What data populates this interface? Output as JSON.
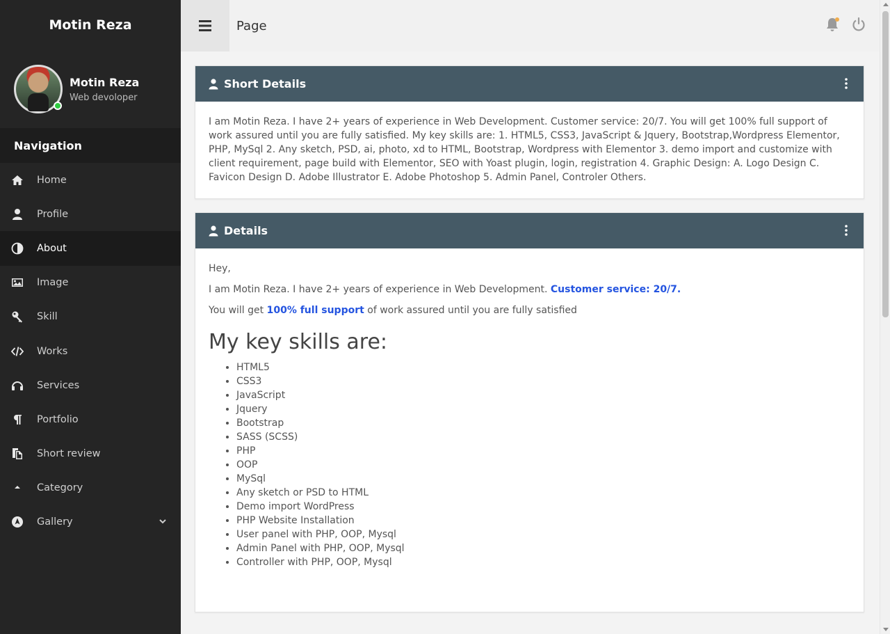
{
  "brand": {
    "name": "Motin Reza"
  },
  "user": {
    "name": "Motin Reza",
    "role": "Web devoloper"
  },
  "sidebar": {
    "nav_title": "Navigation",
    "items": [
      {
        "label": "Home",
        "icon": "home-icon"
      },
      {
        "label": "Profile",
        "icon": "user-icon"
      },
      {
        "label": "About",
        "icon": "contrast-icon"
      },
      {
        "label": "Image",
        "icon": "image-icon"
      },
      {
        "label": "Skill",
        "icon": "key-icon"
      },
      {
        "label": "Works",
        "icon": "code-icon"
      },
      {
        "label": "Services",
        "icon": "headphones-icon"
      },
      {
        "label": "Portfolio",
        "icon": "paragraph-icon"
      },
      {
        "label": "Short review",
        "icon": "copy-icon"
      },
      {
        "label": "Category",
        "icon": "eject-icon"
      },
      {
        "label": "Gallery",
        "icon": "compass-icon"
      }
    ],
    "active_index": 2
  },
  "header": {
    "title": "Page"
  },
  "colors": {
    "accent": "#2454e0",
    "card_header": "#455a66",
    "sidebar": "#252525",
    "online": "#2ecc40",
    "notification": "#f0ad4e"
  },
  "short_details": {
    "title": "Short Details",
    "text": "I am Motin Reza. I have 2+ years of experience in Web Development. Customer service: 20/7. You will get 100% full support of work assured until you are fully satisfied. My key skills are: 1. HTML5, CSS3, JavaScript & Jquery, Bootstrap,Wordpress Elementor, PHP, MySql 2. Any sketch, PSD, ai, photo, xd to HTML, Bootstrap, Wordpress with Elementor 3. demo import and customize with client requirement, page build with Elementor, SEO with Yoast plugin, login, registration 4. Graphic Design: A. Logo Design C. Favicon Design D. Adobe Illustrator E. Adobe Photoshop 5. Admin Panel, Controler Others."
  },
  "details": {
    "title": "Details",
    "greeting": "Hey,",
    "intro_text": "I am Motin Reza. I have 2+ years of experience in Web Development.",
    "intro_highlight": "Customer service: 20/7.",
    "support_prefix": "You will get",
    "support_highlight": "100% full support",
    "support_suffix": "of work assured until you are fully satisfied",
    "skills_heading": "My key skills are:",
    "skills": [
      "HTML5",
      "CSS3",
      "JavaScript",
      "Jquery",
      "Bootstrap",
      "SASS (SCSS)",
      "PHP",
      "OOP",
      "MySql",
      "Any sketch or PSD to HTML",
      "Demo import WordPress",
      "PHP Website Installation",
      "User panel with PHP, OOP, Mysql",
      "Admin Panel with PHP, OOP, Mysql",
      "Controller with PHP, OOP, Mysql"
    ]
  }
}
